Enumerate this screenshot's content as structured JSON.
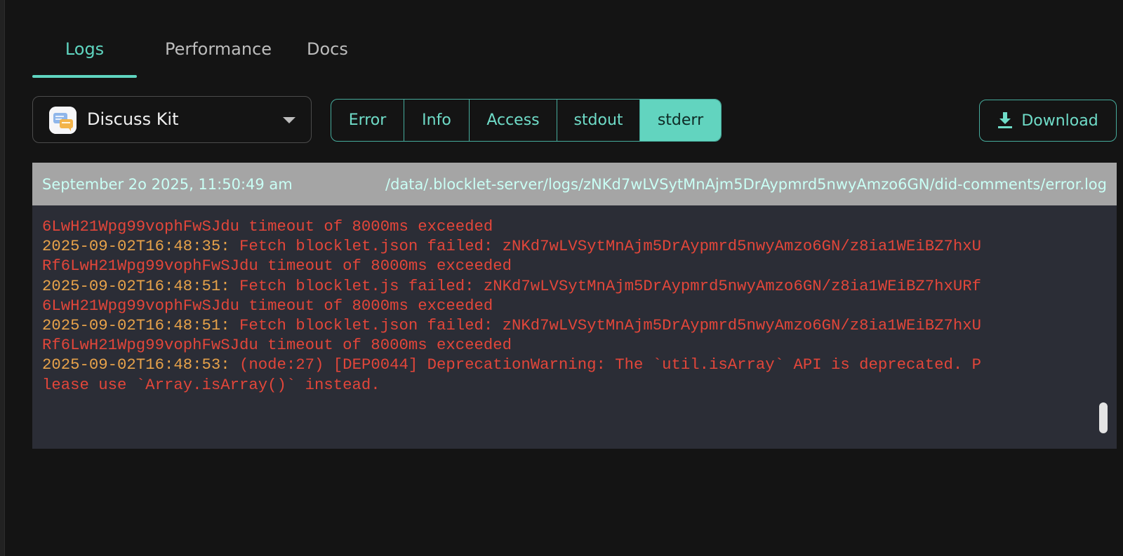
{
  "tabs": [
    {
      "label": "Logs"
    },
    {
      "label": "Performance"
    },
    {
      "label": "Docs"
    }
  ],
  "app_select": {
    "value": "Discuss Kit"
  },
  "log_types": [
    {
      "label": "Error"
    },
    {
      "label": "Info"
    },
    {
      "label": "Access"
    },
    {
      "label": "stdout"
    },
    {
      "label": "stderr"
    }
  ],
  "download": {
    "label": "Download"
  },
  "log": {
    "timestamp": "September 2o 2025, 11:50:49 am",
    "path": "/data/.blocklet-server/logs/zNKd7wLVSytMnAjm5DrAypmrd5nwyAmzo6GN/did-comments/error.log",
    "lines": [
      {
        "ts": "",
        "text": "6LwH21Wpg99vophFwSJdu timeout of 8000ms exceeded"
      },
      {
        "ts": "2025-09-02T16:48:35: ",
        "text": "Fetch blocklet.json failed: zNKd7wLVSytMnAjm5DrAypmrd5nwyAmzo6GN/z8ia1WEiBZ7hxU"
      },
      {
        "ts": "",
        "text": "Rf6LwH21Wpg99vophFwSJdu timeout of 8000ms exceeded"
      },
      {
        "ts": "2025-09-02T16:48:51: ",
        "text": "Fetch blocklet.js failed: zNKd7wLVSytMnAjm5DrAypmrd5nwyAmzo6GN/z8ia1WEiBZ7hxURf"
      },
      {
        "ts": "",
        "text": "6LwH21Wpg99vophFwSJdu timeout of 8000ms exceeded"
      },
      {
        "ts": "2025-09-02T16:48:51: ",
        "text": "Fetch blocklet.json failed: zNKd7wLVSytMnAjm5DrAypmrd5nwyAmzo6GN/z8ia1WEiBZ7hxU"
      },
      {
        "ts": "",
        "text": "Rf6LwH21Wpg99vophFwSJdu timeout of 8000ms exceeded"
      },
      {
        "ts": "2025-09-02T16:48:53: ",
        "text": "(node:27) [DEP0044] DeprecationWarning: The `util.isArray` API is deprecated. P"
      },
      {
        "ts": "",
        "text": "lease use `Array.isArray()` instead."
      }
    ]
  },
  "colors": {
    "accent": "#5fd5c0",
    "log_error": "#e2463a",
    "log_timestamp": "#e7a24a"
  }
}
